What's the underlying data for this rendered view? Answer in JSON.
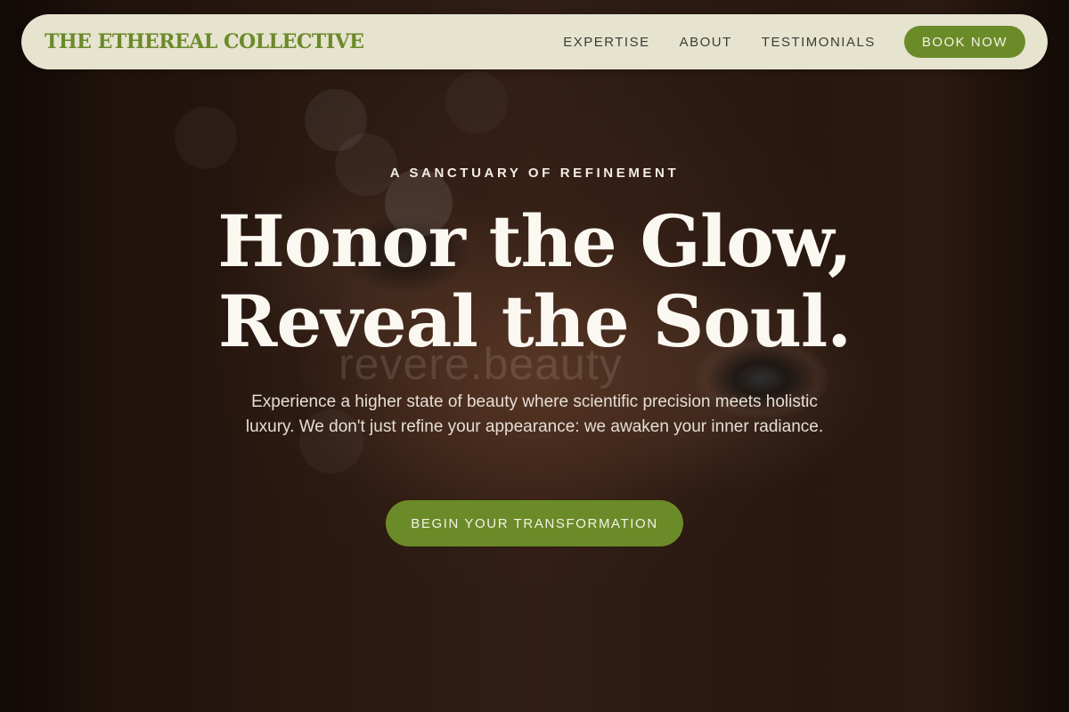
{
  "nav": {
    "brand": "THE ETHEREAL COLLECTIVE",
    "links": [
      "EXPERTISE",
      "ABOUT",
      "TESTIMONIALS"
    ],
    "cta": "BOOK NOW"
  },
  "hero": {
    "eyebrow": "A SANCTUARY OF REFINEMENT",
    "headline_line1": "Honor the Glow,",
    "headline_line2": "Reveal the Soul.",
    "subtext": "Experience a higher state of beauty where scientific precision meets holistic luxury. We don't just refine your appearance: we awaken your inner radiance.",
    "cta": "BEGIN YOUR TRANSFORMATION",
    "watermark": "revere.beauty"
  },
  "colors": {
    "accent": "#6b8a28",
    "nav_background": "#e6e3cf",
    "brand_text": "#6b8a2a"
  }
}
